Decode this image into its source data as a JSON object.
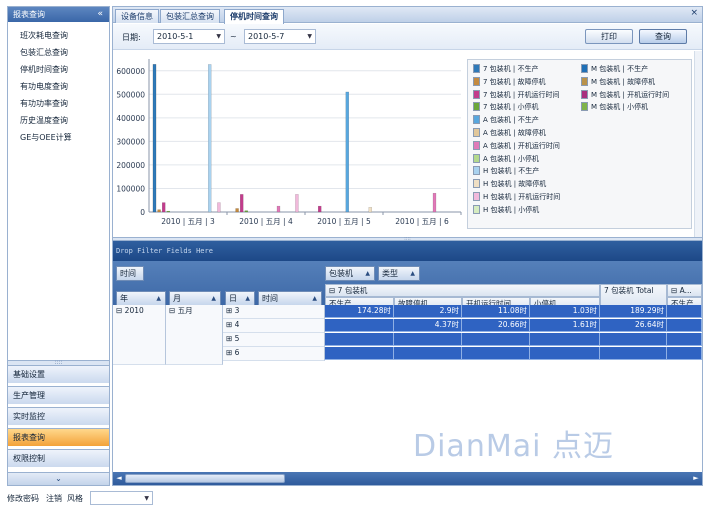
{
  "sidebar": {
    "header": "报表查询",
    "collapse_glyph": "«",
    "items": [
      "班次耗电查询",
      "包装汇总查询",
      "停机时间查询",
      "有功电度查询",
      "有功功率查询",
      "历史温度查询",
      "GE与OEE计算"
    ],
    "groups": [
      "基础设置",
      "生产管理",
      "实时监控",
      "报表查询",
      "权限控制"
    ],
    "active_group": "报表查询",
    "bottom_glyph": "⌄",
    "splitter_glyph": "::::"
  },
  "tabs": {
    "items": [
      "设备信息",
      "包装汇总查询",
      "停机时间查询"
    ],
    "active": "停机时间查询",
    "close_glyph": "×"
  },
  "filter": {
    "date_label": "日期:",
    "start_date": "2010-5-1",
    "tilde": "~",
    "end_date": "2010-5-7",
    "print_label": "打印",
    "query_label": "查询"
  },
  "chart_data": {
    "type": "bar",
    "categories": [
      "2010 | 五月 | 3",
      "2010 | 五月 | 4",
      "2010 | 五月 | 5",
      "2010 | 五月 | 6"
    ],
    "y_ticks": [
      "0",
      "100000",
      "200000",
      "300000",
      "400000",
      "500000",
      "600000"
    ],
    "ylim": [
      0,
      650000
    ],
    "series": [
      {
        "name": "7 包装机 | 不生产",
        "color": "#2f79b8",
        "values": [
          627000,
          0,
          0,
          0
        ]
      },
      {
        "name": "7 包装机 | 故障停机",
        "color": "#c48a3f",
        "values": [
          10000,
          15000,
          0,
          0
        ]
      },
      {
        "name": "7 包装机 | 开机运行时间",
        "color": "#c23c8c",
        "values": [
          40000,
          75000,
          25000,
          0
        ]
      },
      {
        "name": "7 包装机 | 小停机",
        "color": "#6aa63a",
        "values": [
          3700,
          5700,
          0,
          0
        ]
      },
      {
        "name": "M 包装机 | 不生产",
        "color": "#1f6fb5",
        "values": [
          0,
          0,
          0,
          0
        ]
      },
      {
        "name": "M 包装机 | 故障停机",
        "color": "#b9924a",
        "values": [
          0,
          0,
          0,
          0
        ]
      },
      {
        "name": "M 包装机 | 开机运行时间",
        "color": "#a8307e",
        "values": [
          0,
          0,
          0,
          0
        ]
      },
      {
        "name": "M 包装机 | 小停机",
        "color": "#7fb34a",
        "values": [
          0,
          0,
          0,
          0
        ]
      },
      {
        "name": "A 包装机 | 不生产",
        "color": "#58a7de",
        "values": [
          0,
          0,
          0,
          0
        ]
      },
      {
        "name": "A 包装机 | 故障停机",
        "color": "#e1c79a",
        "values": [
          0,
          0,
          0,
          0
        ]
      },
      {
        "name": "A 包装机 | 开机运行时间",
        "color": "#e07ab8",
        "values": [
          0,
          0,
          0,
          0
        ]
      },
      {
        "name": "A 包装机 | 小停机",
        "color": "#b4d98c",
        "values": [
          0,
          0,
          0,
          0
        ]
      },
      {
        "name": "H 包装机 | 不生产",
        "color": "#a9d2ef",
        "values": [
          0,
          0,
          0,
          0
        ]
      },
      {
        "name": "H 包装机 | 故障停机",
        "color": "#efdfc4",
        "values": [
          0,
          0,
          0,
          0
        ]
      },
      {
        "name": "H 包装机 | 开机运行时间",
        "color": "#f1b9db",
        "values": [
          0,
          0,
          0,
          0
        ]
      },
      {
        "name": "H 包装机 | 小停机",
        "color": "#d6ecc0",
        "values": [
          0,
          0,
          0,
          0
        ]
      }
    ],
    "extra_bars": [
      {
        "category": 0,
        "series": "H 包装机 | 不生产",
        "value": 627000
      },
      {
        "category": 0,
        "series": "7 包装机 | 不生产",
        "value": 627000
      },
      {
        "category": 0,
        "series": "H 包装机 | 开机运行时间",
        "value": 40000
      },
      {
        "category": 1,
        "series": "H 包装机 | 开机运行时间",
        "value": 75000
      },
      {
        "category": 1,
        "series": "A 包装机 | 开机运行时间",
        "value": 25000
      },
      {
        "category": 2,
        "series": "A 包装机 | 不生产",
        "value": 510000
      },
      {
        "category": 2,
        "series": "H 包装机 | 故障停机",
        "value": 20000
      },
      {
        "category": 3,
        "series": "A 包装机 | 开机运行时间",
        "value": 80000
      }
    ],
    "legend_position": "right",
    "grid": true
  },
  "pivot": {
    "drop_filter_text": "Drop Filter Fields Here",
    "row_area_field": "时间",
    "column_fields": [
      "包装机",
      "类型"
    ],
    "row_fields": [
      "年",
      "月",
      "日",
      "时间"
    ],
    "group_header": "⊟ 7 包装机",
    "group_total": "7 包装机 Total",
    "group_next": "⊟ A...",
    "measures": [
      "不生产",
      "故障停机",
      "开机运行时间",
      "小停机"
    ],
    "next_measure": "不生产",
    "year": "⊟ 2010",
    "month": "⊟ 五月",
    "rows": [
      {
        "day": "⊞ 3",
        "values": [
          "174.28时",
          "2.9时",
          "11.08时",
          "1.03时"
        ],
        "total": "189.29时"
      },
      {
        "day": "⊞ 4",
        "values": [
          "",
          "4.37时",
          "20.66时",
          "1.61时"
        ],
        "total": "26.64时"
      },
      {
        "day": "⊞ 5",
        "values": [
          "",
          "",
          "",
          ""
        ],
        "total": ""
      },
      {
        "day": "⊞ 6",
        "values": [
          "",
          "",
          "",
          ""
        ],
        "total": ""
      }
    ],
    "watermark": "DianMai 点迈",
    "scroll_left": "◄",
    "scroll_right": "►"
  },
  "statusbar": {
    "links": [
      "修改密码",
      "注销",
      "风格"
    ],
    "style_value": ""
  },
  "colors": {
    "accent": "#3d68a6",
    "selected_cell": "#2f63c2",
    "active_group": "#f3a23a"
  }
}
